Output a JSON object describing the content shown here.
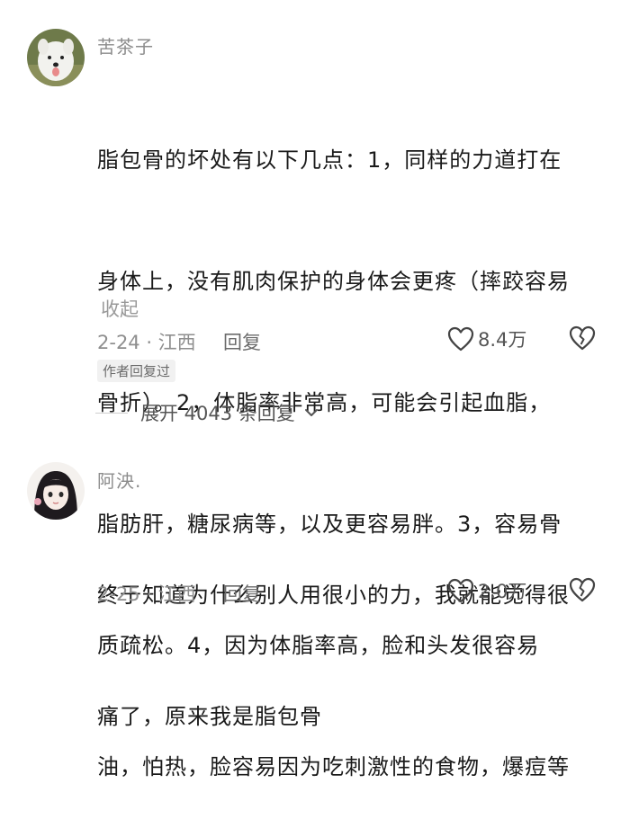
{
  "comments": [
    {
      "username": "苦茶子",
      "text_lines": [
        "脂包骨的坏处有以下几点：1，同样的力道打在",
        "身体上，没有肌肉保护的身体会更疼（摔跤容易",
        "骨折）。2，体脂率非常高，可能会引起血脂，",
        "脂肪肝，糖尿病等，以及更容易胖。3，容易骨",
        "质疏松。4，因为体脂率高，脸和头发很容易",
        "油，怕热，脸容易因为吃刺激性的食物，爆痘等"
      ],
      "collapse_label": "收起",
      "date_location": "2-24 · 江西",
      "reply_label": "回复",
      "likes": "8.4万",
      "author_badge": "作者回复过",
      "expand_label": "展开 4043 条回复"
    },
    {
      "username": "阿泱.",
      "text_lines": [
        "终于知道为什么别人用很小的力，我就能觉得很",
        "痛了，原来我是脂包骨"
      ],
      "date_location": "2-25 · 江西",
      "reply_label": "回复",
      "likes": "2.0万"
    }
  ],
  "icons": {
    "like": "heart-outline-icon",
    "dislike": "broken-heart-icon",
    "expand": "chevron-down-icon"
  }
}
